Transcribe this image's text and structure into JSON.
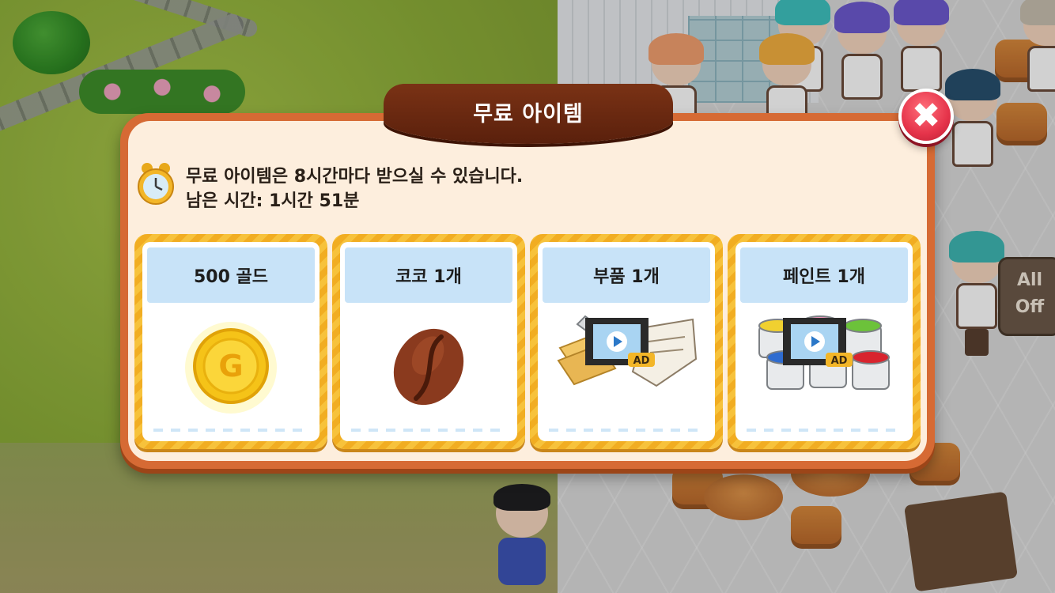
{
  "dialog": {
    "title": "무료 아이템",
    "close_label": "✖",
    "info_line_1": "무료 아이템은 8시간마다 받으실 수 있습니다.",
    "info_line_2": "남은 시간: 1시간 51분"
  },
  "items": [
    {
      "label": "500 골드",
      "icon": "gold-coin-icon",
      "has_ad": false
    },
    {
      "label": "코코 1개",
      "icon": "coffee-bean-icon",
      "has_ad": false
    },
    {
      "label": "부품 1개",
      "icon": "parts-icon",
      "has_ad": true
    },
    {
      "label": "페인트 1개",
      "icon": "paint-buckets-icon",
      "has_ad": true
    }
  ],
  "ad_badge": {
    "label": "AD"
  },
  "side_button": {
    "line1": "All",
    "line2": "Off"
  },
  "colors": {
    "frame": "#d66a34",
    "panel": "#fdeedd",
    "ribbon": "#6a2a10",
    "close": "#e5334a",
    "card_border": "#f4b52e",
    "card_label_bg": "#c8e3f8"
  }
}
